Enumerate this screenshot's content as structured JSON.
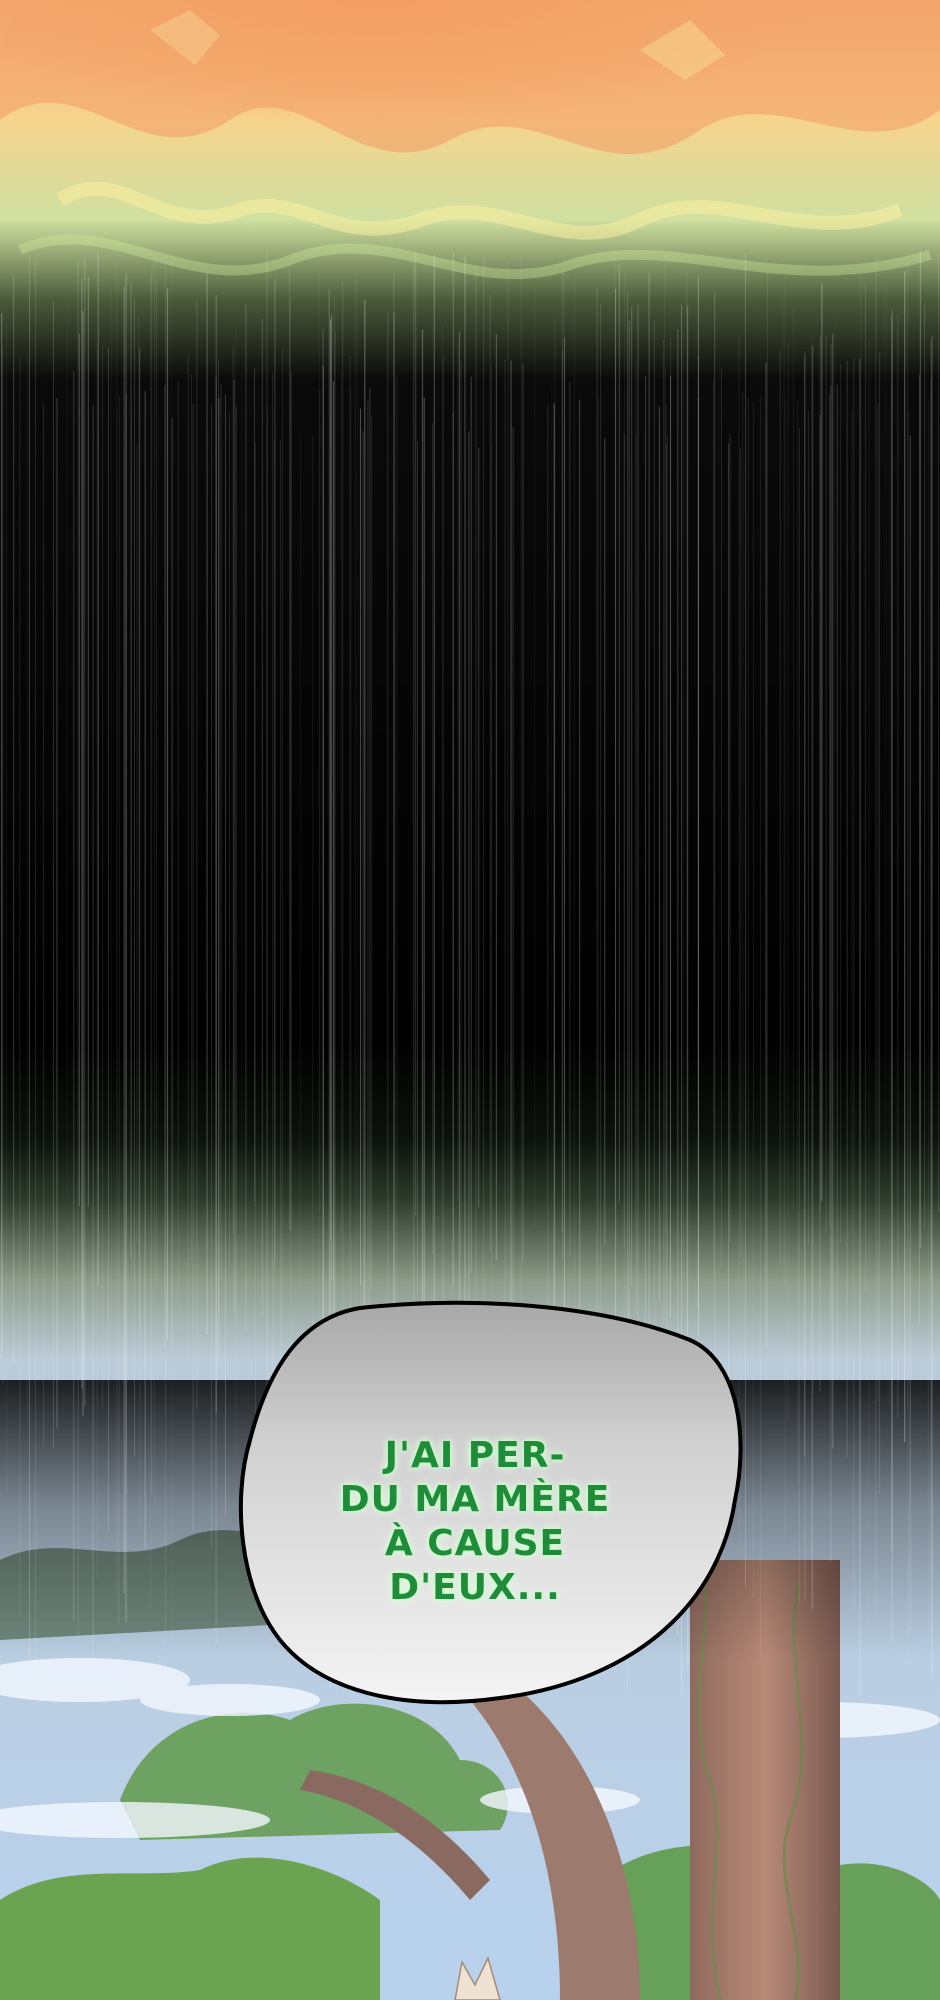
{
  "panel": {
    "bubble_lines": [
      "J'AI PER-",
      "DU MA MÈRE",
      "À CAUSE",
      "D'EUX..."
    ]
  },
  "colors": {
    "text_green": "#1f8c3a",
    "bubble_fill": "#dcdcdc",
    "bubble_outline": "#000000",
    "fire_orange": "#f0a060",
    "sky_blue": "#a9c8ea",
    "foliage_green": "#5f9a4a",
    "trunk_brown": "#a6786a"
  },
  "icons": [
    "speech-bubble",
    "speed-lines"
  ]
}
